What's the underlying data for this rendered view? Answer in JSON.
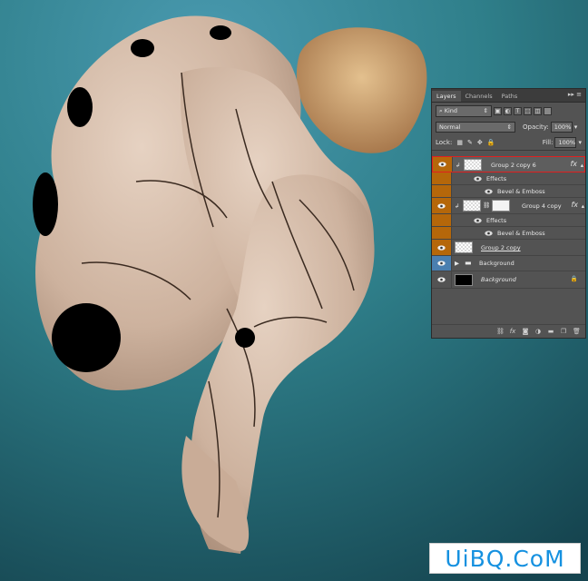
{
  "layers_panel": {
    "tabs": [
      "Layers",
      "Channels",
      "Paths"
    ],
    "filter_kind": "Kind",
    "blend_mode": "Normal",
    "opacity_label": "Opacity:",
    "opacity_value": "100%",
    "lock_label": "Lock:",
    "fill_label": "Fill:",
    "fill_value": "100%",
    "layers": [
      {
        "name": "Group 2 copy 6",
        "fx": "fx",
        "selected": true
      },
      {
        "name": "Effects"
      },
      {
        "name": "Bevel & Emboss"
      },
      {
        "name": "Group 4 copy",
        "fx": "fx"
      },
      {
        "name": "Effects"
      },
      {
        "name": "Bevel & Emboss"
      },
      {
        "name": "Group 2 copy"
      },
      {
        "name": "Background"
      },
      {
        "name": "Background"
      }
    ]
  },
  "watermark": "UiBQ.CoM",
  "colors": {
    "panel_bg": "#535353",
    "selected_outline": "#e02020",
    "clip_gutter": "#b5670a",
    "folder_gutter": "#4a7fb0",
    "watermark_text": "#1591e0"
  }
}
